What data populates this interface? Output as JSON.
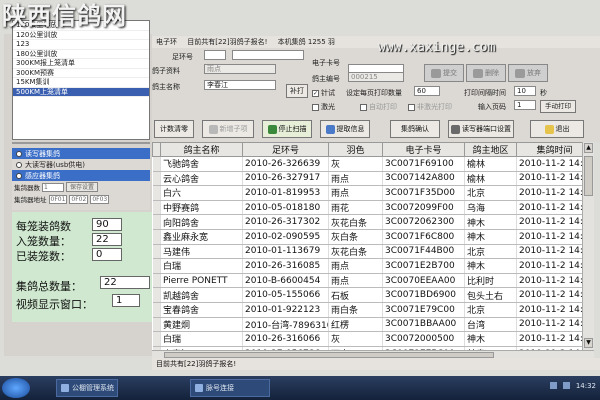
{
  "watermark": {
    "title": "陕西信鸽网",
    "url": "www.xaxinge.com"
  },
  "left_list": {
    "items": [
      {
        "label": "120公里导放",
        "selected": false
      },
      {
        "label": "120公里训放",
        "selected": false
      },
      {
        "label": "123",
        "selected": false
      },
      {
        "label": "180公里训放",
        "selected": false
      },
      {
        "label": "300KM报上笼清单",
        "selected": false
      },
      {
        "label": "300KM预赛",
        "selected": false
      },
      {
        "label": "15KM集训",
        "selected": false
      },
      {
        "label": "500KM上笼清单",
        "selected": true
      }
    ]
  },
  "reader": {
    "options": [
      {
        "label": "读写器集鸽",
        "selected": true
      },
      {
        "label": "大读写器(usb供电)",
        "selected": false
      },
      {
        "label": "感应器集鸽",
        "selected": false
      }
    ],
    "device_label": "集鸽器数",
    "device_value": "1",
    "device_btn": "保存设置",
    "address_label": "集鸽器地址",
    "address_values": [
      "0F01",
      "0F02",
      "0F03"
    ]
  },
  "stats": {
    "per_cage_label": "每笼装鸽数",
    "per_cage_value": "90",
    "cage_count_label": "入笼数量：",
    "cage_count_value": "22",
    "loaded_label": "已装笼数：",
    "loaded_value": "0",
    "total_label": "集鸽总数量：",
    "total_value": "22",
    "video_label": "视频显示窗口：",
    "video_value": "1"
  },
  "topbar": {
    "items": [
      "电子环",
      "目前共有[22]羽鸽子报名!",
      "本机集鸽 1255 羽"
    ]
  },
  "form": {
    "ring_label": "足环号",
    "ring_value": "",
    "pigeon_label": "鸽子资料",
    "pigeon_value": "雨点",
    "owner_label": "鸽主名称",
    "owner_value": "李春江",
    "chip_label": "电子卡号",
    "chip_value": "",
    "owner_no_label": "鸽主编号",
    "owner_no_value": "000215",
    "print_btn": "补打",
    "check_label": "针试",
    "laser_label": "激光",
    "print_count_label": "设定每页打印数量",
    "print_count_value": "60",
    "auto_print_label": "自动打印",
    "no_print_label": "非激光打印",
    "interval_label": "打印间隔时间",
    "interval_value": "10",
    "page_label": "输入页码",
    "page_value": "1",
    "manual_print_btn": "手动打印",
    "submit_tile": "提交",
    "delete_tile": "删除",
    "cancel_tile": "放弃",
    "unit_s": "秒"
  },
  "toolbar": {
    "clear_btn": "计数清零",
    "new_btn": "新增子项",
    "stop_btn": "停止扫描",
    "extract_btn": "提取信息",
    "confirm_btn": "集鸽确认",
    "reader_btn": "读写器端口设置",
    "exit_btn": "退出"
  },
  "table": {
    "columns": [
      "鸽主名称",
      "足环号",
      "羽色",
      "电子卡号",
      "鸽主地区",
      "集鸽时间"
    ],
    "rows": [
      [
        "飞驰鸽舍",
        "2010-26-326639",
        "灰",
        "3C0071F69100",
        "榆林",
        "2010-11-2 14:30"
      ],
      [
        "云心鸽舍",
        "2010-26-327917",
        "雨点",
        "3C007142A800",
        "榆林",
        "2010-11-2 14:30"
      ],
      [
        "白六",
        "2010-01-819953",
        "雨点",
        "3C0071F35D00",
        "北京",
        "2010-11-2 14:30"
      ],
      [
        "中野赛鸽",
        "2010-05-018180",
        "雨花",
        "3C0072099F00",
        "乌海",
        "2010-11-2 14:30"
      ],
      [
        "向阳鸽舍",
        "2010-26-317302",
        "灰花白条",
        "3C0072062300",
        "神木",
        "2010-11-2 14:30"
      ],
      [
        "鑫业麻永宽",
        "2010-02-090595",
        "灰白条",
        "3C0071F6C800",
        "神木",
        "2010-11-2 14:30"
      ],
      [
        "马建伟",
        "2010-01-113679",
        "灰花白条",
        "3C0071F44B00",
        "北京",
        "2010-11-2 14:30"
      ],
      [
        "白瑞",
        "2010-26-316085",
        "雨点",
        "3C0071E2B700",
        "神木",
        "2010-11-2 14:30"
      ],
      [
        "Pierre PONETT",
        "2010-B-6600454",
        "雨点",
        "3C0070EEAA00",
        "比利时",
        "2010-11-2 14:30"
      ],
      [
        "凯越鸽舍",
        "2010-05-155066",
        "石板",
        "3C0071BD6900",
        "包头土右",
        "2010-11-2 14:30"
      ],
      [
        "宝春鸽舍",
        "2010-01-922123",
        "雨白条",
        "3C0071E79C00",
        "北京",
        "2010-11-2 14:30"
      ],
      [
        "黄建炯",
        "2010-台湾-7896310",
        "红楞",
        "3C0071BBAA00",
        "台湾",
        "2010-11-2 14:30"
      ],
      [
        "白瑞",
        "2010-26-316066",
        "灰",
        "3C0072000500",
        "神木",
        "2010-11-2 14:30"
      ],
      [
        "李春江",
        "2010-27-056786",
        "雨点",
        "3C0071EE5C00",
        "甘肃",
        "2010-11-2 14:30"
      ]
    ],
    "current_row_index": 13
  },
  "status": {
    "text": "目前共有[22]羽鸽子报名!"
  },
  "taskbar": {
    "tasks": [
      {
        "label": "公棚管理系统"
      },
      {
        "label": "脉号连接"
      }
    ],
    "clock": "14:32"
  }
}
